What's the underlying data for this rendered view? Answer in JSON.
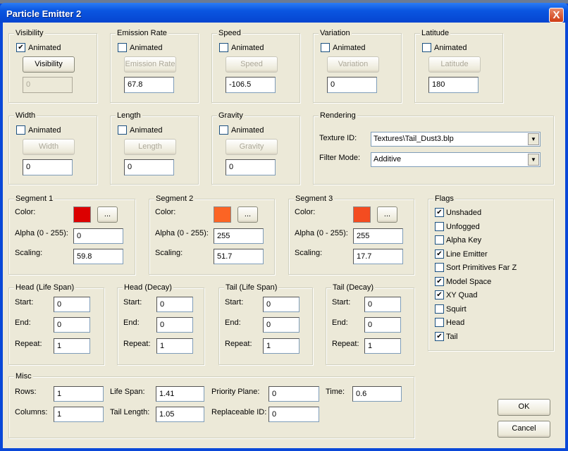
{
  "window": {
    "title": "Particle Emitter 2",
    "close_label": "X"
  },
  "row1": [
    {
      "name": "visibility",
      "title": "Visibility",
      "animated": true,
      "button": "Visibility",
      "button_enabled": true,
      "value": "0",
      "value_enabled": false
    },
    {
      "name": "emission-rate",
      "title": "Emission Rate",
      "animated": false,
      "button": "Emission Rate",
      "button_enabled": false,
      "value": "67.8",
      "value_enabled": true
    },
    {
      "name": "speed",
      "title": "Speed",
      "animated": false,
      "button": "Speed",
      "button_enabled": false,
      "value": "-106.5",
      "value_enabled": true
    },
    {
      "name": "variation",
      "title": "Variation",
      "animated": false,
      "button": "Variation",
      "button_enabled": false,
      "value": "0",
      "value_enabled": true
    },
    {
      "name": "latitude",
      "title": "Latitude",
      "animated": false,
      "button": "Latitude",
      "button_enabled": false,
      "value": "180",
      "value_enabled": true
    }
  ],
  "row2": [
    {
      "name": "width",
      "title": "Width",
      "animated": false,
      "button": "Width",
      "button_enabled": false,
      "value": "0",
      "value_enabled": true
    },
    {
      "name": "length",
      "title": "Length",
      "animated": false,
      "button": "Length",
      "button_enabled": false,
      "value": "0",
      "value_enabled": true
    },
    {
      "name": "gravity",
      "title": "Gravity",
      "animated": false,
      "button": "Gravity",
      "button_enabled": false,
      "value": "0",
      "value_enabled": true
    }
  ],
  "animated_label": "Animated",
  "rendering": {
    "title": "Rendering",
    "texture_label": "Texture ID:",
    "texture_value": "Textures\\Tail_Dust3.blp",
    "filter_label": "Filter Mode:",
    "filter_value": "Additive"
  },
  "segments": [
    {
      "title": "Segment 1",
      "color": "#dc0000",
      "alpha": "0",
      "scaling": "59.8"
    },
    {
      "title": "Segment 2",
      "color": "#fc6424",
      "alpha": "255",
      "scaling": "51.7"
    },
    {
      "title": "Segment 3",
      "color": "#f44c20",
      "alpha": "255",
      "scaling": "17.7"
    }
  ],
  "segment_labels": {
    "color": "Color:",
    "alpha": "Alpha (0 - 255):",
    "scaling": "Scaling:",
    "picker": "..."
  },
  "lifespans": [
    {
      "title": "Head (Life Span)",
      "start": "0",
      "end": "0",
      "repeat": "1"
    },
    {
      "title": "Head (Decay)",
      "start": "0",
      "end": "0",
      "repeat": "1"
    },
    {
      "title": "Tail (Life Span)",
      "start": "0",
      "end": "0",
      "repeat": "1"
    },
    {
      "title": "Tail (Decay)",
      "start": "0",
      "end": "0",
      "repeat": "1"
    }
  ],
  "lifespan_labels": {
    "start": "Start:",
    "end": "End:",
    "repeat": "Repeat:"
  },
  "flags": {
    "title": "Flags",
    "items": [
      {
        "label": "Unshaded",
        "checked": true
      },
      {
        "label": "Unfogged",
        "checked": false
      },
      {
        "label": "Alpha Key",
        "checked": false
      },
      {
        "label": "Line Emitter",
        "checked": true
      },
      {
        "label": "Sort Primitives Far Z",
        "checked": false
      },
      {
        "label": "Model Space",
        "checked": true
      },
      {
        "label": "XY Quad",
        "checked": true
      },
      {
        "label": "Squirt",
        "checked": false
      },
      {
        "label": "Head",
        "checked": false
      },
      {
        "label": "Tail",
        "checked": true
      }
    ]
  },
  "misc": {
    "title": "Misc",
    "fields": [
      {
        "label": "Rows:",
        "value": "1"
      },
      {
        "label": "Columns:",
        "value": "1"
      },
      {
        "label": "Life Span:",
        "value": "1.41"
      },
      {
        "label": "Tail Length:",
        "value": "1.05"
      },
      {
        "label": "Priority Plane:",
        "value": "0"
      },
      {
        "label": "Replaceable ID:",
        "value": "0"
      },
      {
        "label": "Time:",
        "value": "0.6"
      }
    ]
  },
  "buttons": {
    "ok": "OK",
    "cancel": "Cancel"
  }
}
